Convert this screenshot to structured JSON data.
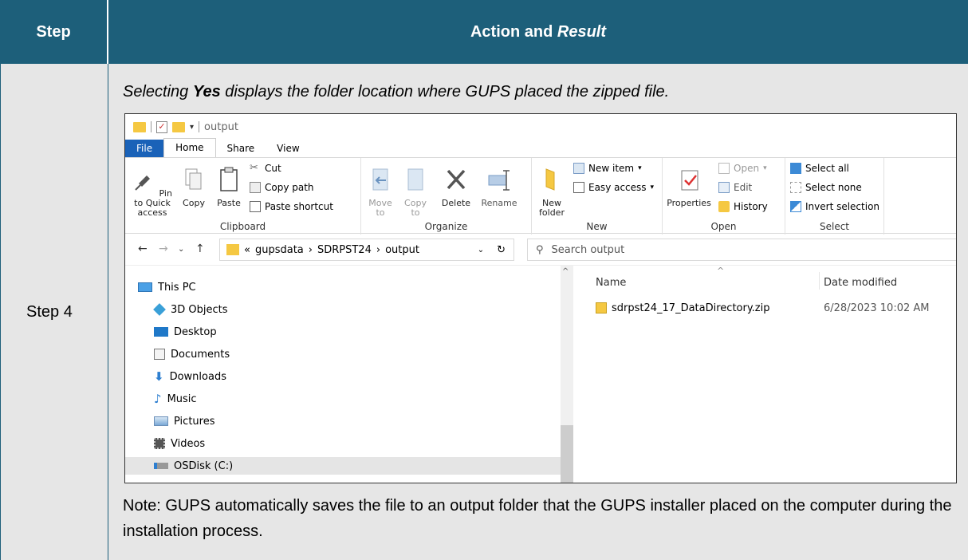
{
  "table": {
    "header_step": "Step",
    "header_action_prefix": "Action and ",
    "header_action_italic": "Result",
    "step_label": "Step 4",
    "caption_pre": "Selecting ",
    "caption_bold": "Yes",
    "caption_post": " displays the folder location where GUPS placed the zipped file.",
    "note": "Note: GUPS automatically saves the file to an output folder that the GUPS installer placed on the computer during the installation process."
  },
  "explorer": {
    "title": "output",
    "tabs": [
      {
        "label": "File",
        "icon": "none"
      },
      {
        "label": "Home"
      },
      {
        "label": "Share"
      },
      {
        "label": "View"
      }
    ],
    "ribbon": {
      "clipboard": {
        "label": "Clipboard",
        "pin": "Pin to Quick access",
        "copy": "Copy",
        "paste": "Paste",
        "cut": "Cut",
        "copy_path": "Copy path",
        "paste_shortcut": "Paste shortcut"
      },
      "organize": {
        "label": "Organize",
        "move_to": "Move to",
        "copy_to": "Copy to",
        "delete": "Delete",
        "rename": "Rename"
      },
      "new": {
        "label": "New",
        "new_folder": "New folder",
        "new_item": "New item",
        "easy_access": "Easy access"
      },
      "open": {
        "label": "Open",
        "properties": "Properties",
        "open": "Open",
        "edit": "Edit",
        "history": "History"
      },
      "select": {
        "label": "Select",
        "select_all": "Select all",
        "select_none": "Select none",
        "invert_selection": "Invert selection"
      }
    },
    "address": {
      "chevron": "«",
      "crumbs": [
        "gupsdata",
        "SDRPST24",
        "output"
      ],
      "sep": "›"
    },
    "search_placeholder": "Search output",
    "nav_items": [
      {
        "label": "This PC",
        "icon": "computer-icon"
      },
      {
        "label": "3D Objects",
        "icon": "cube-icon"
      },
      {
        "label": "Desktop",
        "icon": "desktop-icon"
      },
      {
        "label": "Documents",
        "icon": "document-icon"
      },
      {
        "label": "Downloads",
        "icon": "download-icon"
      },
      {
        "label": "Music",
        "icon": "music-icon"
      },
      {
        "label": "Pictures",
        "icon": "pictures-icon"
      },
      {
        "label": "Videos",
        "icon": "video-icon"
      },
      {
        "label": "OSDisk (C:)",
        "icon": "drive-icon"
      }
    ],
    "columns": {
      "name": "Name",
      "date": "Date modified"
    },
    "files": [
      {
        "name": "sdrpst24_17_DataDirectory.zip",
        "date": "6/28/2023 10:02 AM"
      }
    ],
    "colors": {
      "header": "#1d5f7a",
      "file_tab": "#1a62b8",
      "folder": "#f5c842"
    }
  }
}
